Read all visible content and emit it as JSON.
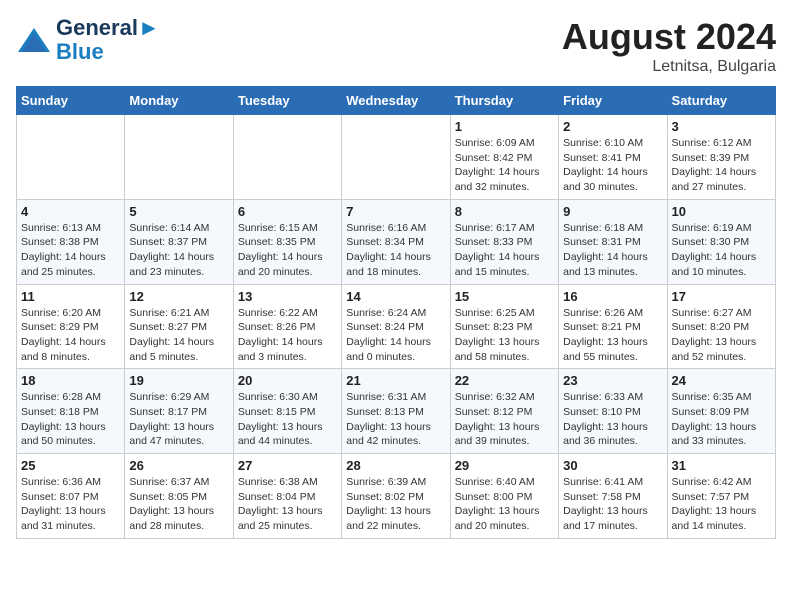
{
  "header": {
    "logo_line1": "General",
    "logo_line2": "Blue",
    "month_title": "August 2024",
    "location": "Letnitsa, Bulgaria"
  },
  "weekdays": [
    "Sunday",
    "Monday",
    "Tuesday",
    "Wednesday",
    "Thursday",
    "Friday",
    "Saturday"
  ],
  "weeks": [
    [
      {
        "day": "",
        "info": ""
      },
      {
        "day": "",
        "info": ""
      },
      {
        "day": "",
        "info": ""
      },
      {
        "day": "",
        "info": ""
      },
      {
        "day": "1",
        "info": "Sunrise: 6:09 AM\nSunset: 8:42 PM\nDaylight: 14 hours\nand 32 minutes."
      },
      {
        "day": "2",
        "info": "Sunrise: 6:10 AM\nSunset: 8:41 PM\nDaylight: 14 hours\nand 30 minutes."
      },
      {
        "day": "3",
        "info": "Sunrise: 6:12 AM\nSunset: 8:39 PM\nDaylight: 14 hours\nand 27 minutes."
      }
    ],
    [
      {
        "day": "4",
        "info": "Sunrise: 6:13 AM\nSunset: 8:38 PM\nDaylight: 14 hours\nand 25 minutes."
      },
      {
        "day": "5",
        "info": "Sunrise: 6:14 AM\nSunset: 8:37 PM\nDaylight: 14 hours\nand 23 minutes."
      },
      {
        "day": "6",
        "info": "Sunrise: 6:15 AM\nSunset: 8:35 PM\nDaylight: 14 hours\nand 20 minutes."
      },
      {
        "day": "7",
        "info": "Sunrise: 6:16 AM\nSunset: 8:34 PM\nDaylight: 14 hours\nand 18 minutes."
      },
      {
        "day": "8",
        "info": "Sunrise: 6:17 AM\nSunset: 8:33 PM\nDaylight: 14 hours\nand 15 minutes."
      },
      {
        "day": "9",
        "info": "Sunrise: 6:18 AM\nSunset: 8:31 PM\nDaylight: 14 hours\nand 13 minutes."
      },
      {
        "day": "10",
        "info": "Sunrise: 6:19 AM\nSunset: 8:30 PM\nDaylight: 14 hours\nand 10 minutes."
      }
    ],
    [
      {
        "day": "11",
        "info": "Sunrise: 6:20 AM\nSunset: 8:29 PM\nDaylight: 14 hours\nand 8 minutes."
      },
      {
        "day": "12",
        "info": "Sunrise: 6:21 AM\nSunset: 8:27 PM\nDaylight: 14 hours\nand 5 minutes."
      },
      {
        "day": "13",
        "info": "Sunrise: 6:22 AM\nSunset: 8:26 PM\nDaylight: 14 hours\nand 3 minutes."
      },
      {
        "day": "14",
        "info": "Sunrise: 6:24 AM\nSunset: 8:24 PM\nDaylight: 14 hours\nand 0 minutes."
      },
      {
        "day": "15",
        "info": "Sunrise: 6:25 AM\nSunset: 8:23 PM\nDaylight: 13 hours\nand 58 minutes."
      },
      {
        "day": "16",
        "info": "Sunrise: 6:26 AM\nSunset: 8:21 PM\nDaylight: 13 hours\nand 55 minutes."
      },
      {
        "day": "17",
        "info": "Sunrise: 6:27 AM\nSunset: 8:20 PM\nDaylight: 13 hours\nand 52 minutes."
      }
    ],
    [
      {
        "day": "18",
        "info": "Sunrise: 6:28 AM\nSunset: 8:18 PM\nDaylight: 13 hours\nand 50 minutes."
      },
      {
        "day": "19",
        "info": "Sunrise: 6:29 AM\nSunset: 8:17 PM\nDaylight: 13 hours\nand 47 minutes."
      },
      {
        "day": "20",
        "info": "Sunrise: 6:30 AM\nSunset: 8:15 PM\nDaylight: 13 hours\nand 44 minutes."
      },
      {
        "day": "21",
        "info": "Sunrise: 6:31 AM\nSunset: 8:13 PM\nDaylight: 13 hours\nand 42 minutes."
      },
      {
        "day": "22",
        "info": "Sunrise: 6:32 AM\nSunset: 8:12 PM\nDaylight: 13 hours\nand 39 minutes."
      },
      {
        "day": "23",
        "info": "Sunrise: 6:33 AM\nSunset: 8:10 PM\nDaylight: 13 hours\nand 36 minutes."
      },
      {
        "day": "24",
        "info": "Sunrise: 6:35 AM\nSunset: 8:09 PM\nDaylight: 13 hours\nand 33 minutes."
      }
    ],
    [
      {
        "day": "25",
        "info": "Sunrise: 6:36 AM\nSunset: 8:07 PM\nDaylight: 13 hours\nand 31 minutes."
      },
      {
        "day": "26",
        "info": "Sunrise: 6:37 AM\nSunset: 8:05 PM\nDaylight: 13 hours\nand 28 minutes."
      },
      {
        "day": "27",
        "info": "Sunrise: 6:38 AM\nSunset: 8:04 PM\nDaylight: 13 hours\nand 25 minutes."
      },
      {
        "day": "28",
        "info": "Sunrise: 6:39 AM\nSunset: 8:02 PM\nDaylight: 13 hours\nand 22 minutes."
      },
      {
        "day": "29",
        "info": "Sunrise: 6:40 AM\nSunset: 8:00 PM\nDaylight: 13 hours\nand 20 minutes."
      },
      {
        "day": "30",
        "info": "Sunrise: 6:41 AM\nSunset: 7:58 PM\nDaylight: 13 hours\nand 17 minutes."
      },
      {
        "day": "31",
        "info": "Sunrise: 6:42 AM\nSunset: 7:57 PM\nDaylight: 13 hours\nand 14 minutes."
      }
    ]
  ]
}
